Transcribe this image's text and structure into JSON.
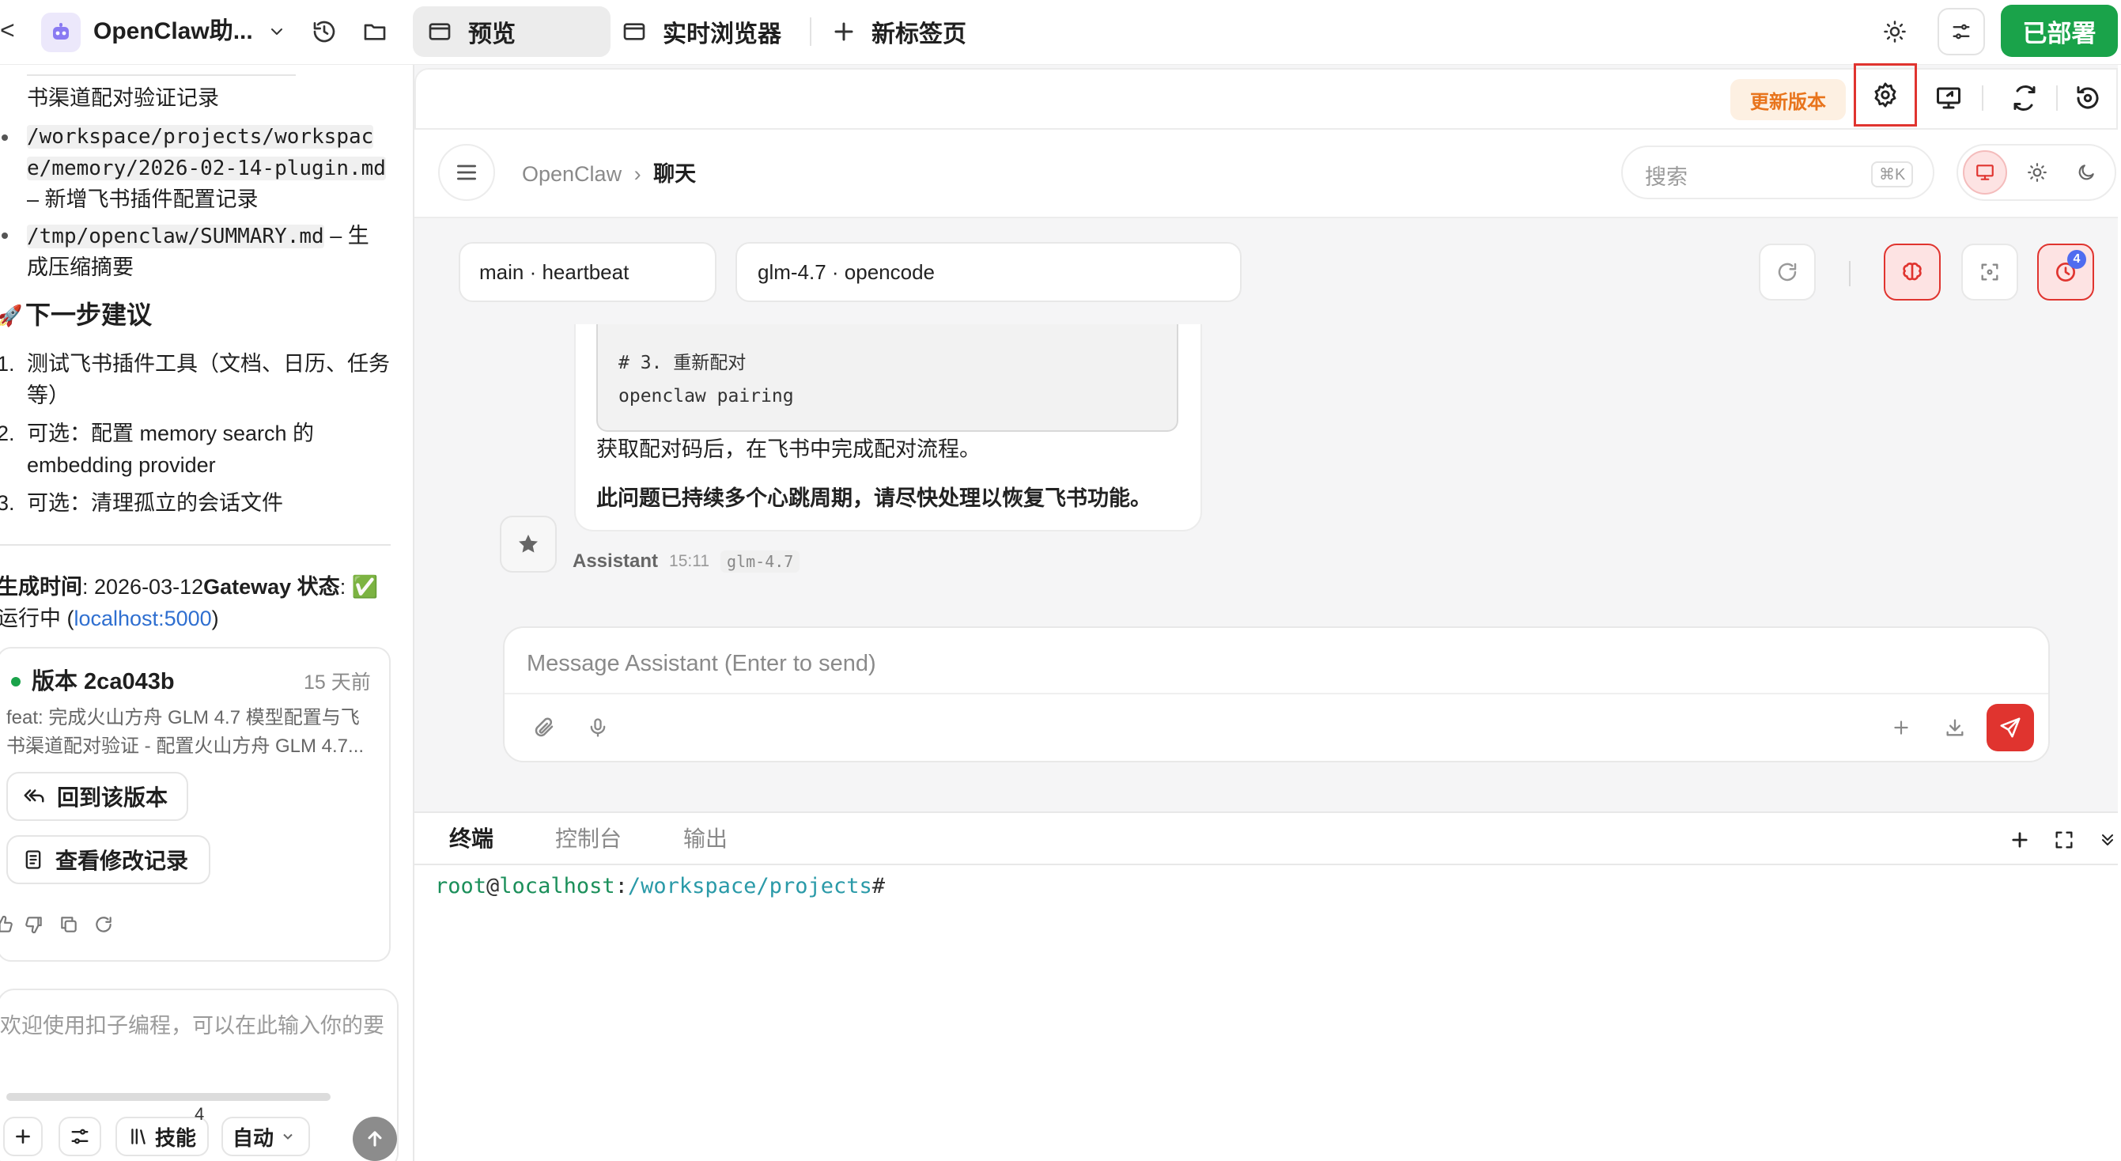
{
  "topbar": {
    "back": "<",
    "app_title": "OpenClaw助...",
    "tabs": [
      {
        "label": "预览"
      },
      {
        "label": "实时浏览器"
      },
      {
        "label": "新标签页"
      }
    ],
    "deployed_label": "已部署"
  },
  "left": {
    "file_lines": {
      "line0": "书渠道配对验证记录",
      "item1_code_a": "/workspace/projects/workspac",
      "item1_code_b": "e/memory/2026-02-14-plugin.md",
      "item1_desc": "– 新增飞书插件配置记录",
      "item2_code": "/tmp/openclaw/SUMMARY.md",
      "item2_desc_a": " – 生",
      "item2_desc_b": "成压缩摘要"
    },
    "next_heading": "下一步建议",
    "next_items": [
      {
        "n": "1.",
        "a": "测试飞书插件工具（文档、日历、任务",
        "b": "等）"
      },
      {
        "n": "2.",
        "a": "可选：配置 memory search 的",
        "b": "embedding provider"
      },
      {
        "n": "3.",
        "a": "可选：清理孤立的会话文件",
        "b": ""
      }
    ],
    "gen_time_label": "生成时间",
    "gen_time_value": ": 2026-03-12",
    "gateway_label": "Gateway 状态",
    "gateway_sep": ": ✅",
    "running_a": "运行中 (",
    "running_link": "localhost:5000",
    "running_b": ")",
    "version_card": {
      "title": "版本 2ca043b",
      "age": "15 天前",
      "desc_a": "feat: 完成火山方舟 GLM 4.7 模型配置与飞",
      "desc_b": "书渠道配对验证 - 配置火山方舟 GLM 4.7...",
      "revert_label": "回到该版本",
      "changes_label": "查看修改记录"
    },
    "input_placeholder": "欢迎使用扣子编程，可以在此输入你的要",
    "skills_label": "技能",
    "skills_count": "4",
    "mode_label": "自动"
  },
  "preview": {
    "update_label": "更新版本",
    "breadcrumb_root": "OpenClaw",
    "breadcrumb_sep": "›",
    "breadcrumb_page": "聊天",
    "search_placeholder": "搜索",
    "search_shortcut": "⌘K",
    "session_select": "main · heartbeat",
    "model_select": "glm-4.7 · opencode",
    "notif_count": "4",
    "code_line1": "# 3. 重新配对",
    "code_line2": "openclaw pairing",
    "msg_line1": "获取配对码后，在飞书中完成配对流程。",
    "msg_line2": "此问题已持续多个心跳周期，请尽快处理以恢复飞书功能。",
    "sender": "Assistant",
    "time": "15:11",
    "model_tag": "glm-4.7",
    "composer_placeholder": "Message Assistant (Enter to send)"
  },
  "terminal": {
    "tabs": [
      {
        "label": "终端"
      },
      {
        "label": "控制台"
      },
      {
        "label": "输出"
      }
    ],
    "user_host": "root",
    "at": "@",
    "host": "localhost",
    "colon": ":",
    "path": "/workspace/projects",
    "prompt": "#"
  },
  "colors": {
    "accent_green": "#1aa34a",
    "accent_red": "#e0342f",
    "update_orange": "#e8741c",
    "terminal_green": "#1b8f5a",
    "terminal_teal": "#2a9aa8",
    "link_blue": "#2f6fd0"
  }
}
